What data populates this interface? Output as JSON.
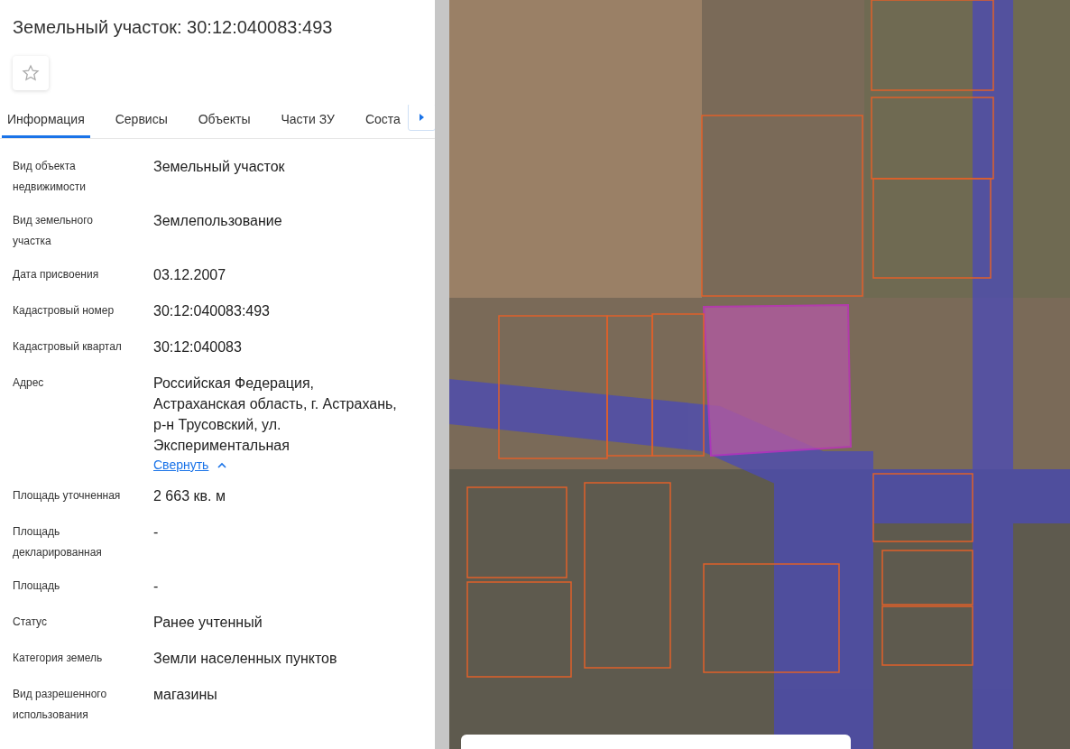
{
  "title": "Земельный участок: 30:12:040083:493",
  "tabs": [
    {
      "label": "Информация",
      "selected": true
    },
    {
      "label": "Сервисы",
      "selected": false
    },
    {
      "label": "Объекты",
      "selected": false
    },
    {
      "label": "Части ЗУ",
      "selected": false
    },
    {
      "label": "Соста",
      "selected": false
    }
  ],
  "fields": [
    {
      "label": "Вид объекта недвижимости",
      "value": "Земельный участок"
    },
    {
      "label": "Вид земельного участка",
      "value": "Землепользование"
    },
    {
      "label": "Дата присвоения",
      "value": "03.12.2007"
    },
    {
      "label": "Кадастровый номер",
      "value": "30:12:040083:493"
    },
    {
      "label": "Кадастровый квартал",
      "value": "30:12:040083"
    },
    {
      "label": "Адрес",
      "value": "Российская Федерация, Астраханская область, г. Астрахань, р-н Трусовский, ул. Экспериментальная",
      "link": "Свернуть"
    },
    {
      "label": "Площадь уточненная",
      "value": "2 663 кв. м"
    },
    {
      "label": "Площадь декларированная",
      "value": "-"
    },
    {
      "label": "Площадь",
      "value": "-"
    },
    {
      "label": "Статус",
      "value": "Ранее учтенный"
    },
    {
      "label": "Категория земель",
      "value": "Земли населенных пунктов"
    },
    {
      "label": "Вид разрешенного использования",
      "value": "магазины"
    }
  ]
}
